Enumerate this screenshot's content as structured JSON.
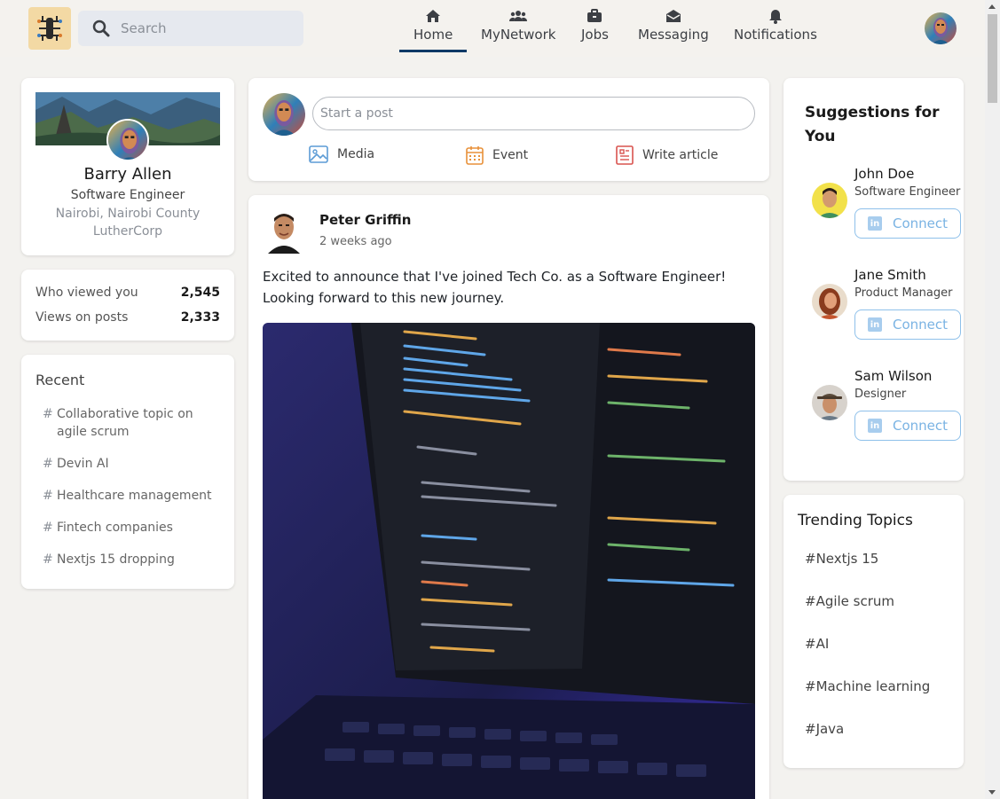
{
  "nav": {
    "search_placeholder": "Search",
    "items": [
      {
        "label": "Home",
        "icon": "home-icon",
        "active": true
      },
      {
        "label": "MyNetwork",
        "icon": "users-icon",
        "active": false
      },
      {
        "label": "Jobs",
        "icon": "briefcase-icon",
        "active": false
      },
      {
        "label": "Messaging",
        "icon": "envelope-icon",
        "active": false
      },
      {
        "label": "Notifications",
        "icon": "bell-icon",
        "active": false
      }
    ]
  },
  "profile": {
    "name": "Barry Allen",
    "title": "Software Engineer",
    "location": "Nairobi, Nairobi County",
    "organization": "LutherCorp"
  },
  "stats": [
    {
      "label": "Who viewed you",
      "value": "2,545"
    },
    {
      "label": "Views on posts",
      "value": "2,333"
    }
  ],
  "recent": {
    "heading": "Recent",
    "items": [
      "Collaborative topic on agile scrum",
      "Devin AI",
      "Healthcare management",
      "Fintech companies",
      "Nextjs 15 dropping"
    ]
  },
  "composer": {
    "placeholder": "Start a post",
    "actions": [
      {
        "label": "Media",
        "icon": "image-icon",
        "color": "#5b9bd5"
      },
      {
        "label": "Event",
        "icon": "calendar-icon",
        "color": "#e8913a"
      },
      {
        "label": "Write article",
        "icon": "article-icon",
        "color": "#d9534f"
      }
    ]
  },
  "post": {
    "author": "Peter Griffin",
    "time": "2 weeks ago",
    "text": "Excited to announce that I've joined Tech Co. as a Software Engineer! Looking forward to this new journey."
  },
  "suggestions": {
    "heading": "Suggestions for You",
    "connect_label": "Connect",
    "people": [
      {
        "name": "John Doe",
        "role": "Software Engineer"
      },
      {
        "name": "Jane Smith",
        "role": "Product Manager"
      },
      {
        "name": "Sam Wilson",
        "role": "Designer"
      }
    ]
  },
  "trending": {
    "heading": "Trending Topics",
    "topics": [
      "#Nextjs 15",
      "#Agile scrum",
      "#AI",
      "#Machine learning",
      "#Java"
    ]
  }
}
